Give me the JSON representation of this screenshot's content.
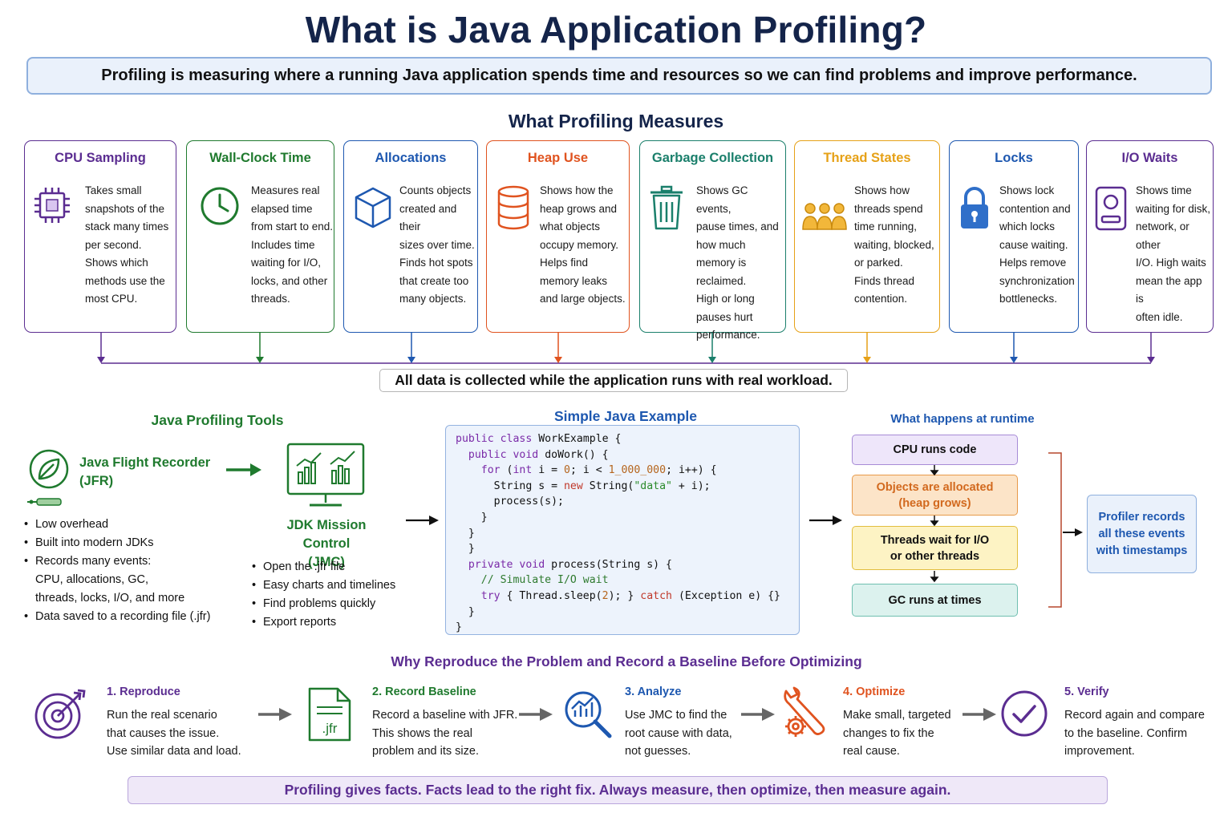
{
  "title": "What is Java Application Profiling?",
  "definition": "Profiling is measuring where a running Java application spends time and resources so we can find problems and improve performance.",
  "measures_heading": "What Profiling Measures",
  "measures": [
    {
      "title": "CPU Sampling",
      "icon": "cpu-chip-icon",
      "color": "#5b2d91",
      "lines": [
        "Takes small",
        "snapshots of the",
        "stack many times",
        "per second.",
        "Shows which",
        "methods use the",
        "most CPU."
      ]
    },
    {
      "title": "Wall-Clock Time",
      "icon": "clock-icon",
      "color": "#1f7a2e",
      "lines": [
        "Measures real",
        "elapsed time",
        "from start to end.",
        "Includes time",
        "waiting for I/O,",
        "locks, and other",
        "threads."
      ]
    },
    {
      "title": "Allocations",
      "icon": "cube-icon",
      "color": "#1e58b0",
      "lines": [
        "Counts objects",
        "created and their",
        "sizes over time.",
        "Finds hot spots",
        "that create too",
        "many objects."
      ]
    },
    {
      "title": "Heap Use",
      "icon": "database-icon",
      "color": "#e0531f",
      "lines": [
        "Shows how the",
        "heap grows and",
        "what objects",
        "occupy memory.",
        "Helps find",
        "memory leaks",
        "and large objects."
      ]
    },
    {
      "title": "Garbage Collection",
      "icon": "trash-can-icon",
      "color": "#1a7f6b",
      "lines": [
        "Shows GC events,",
        "pause times, and",
        "how much",
        "memory is",
        "reclaimed.",
        "High or long",
        "pauses hurt",
        "performance."
      ]
    },
    {
      "title": "Thread States",
      "icon": "people-group-icon",
      "color": "#e6a117",
      "lines": [
        "Shows how",
        "threads spend",
        "time running,",
        "waiting, blocked,",
        "or parked.",
        "Finds thread",
        "contention."
      ]
    },
    {
      "title": "Locks",
      "icon": "padlock-icon",
      "color": "#1e58b0",
      "lines": [
        "Shows lock",
        "contention and",
        "which locks",
        "cause waiting.",
        "Helps remove",
        "synchronization",
        "bottlenecks."
      ]
    },
    {
      "title": "I/O Waits",
      "icon": "disk-drive-icon",
      "color": "#5b2d91",
      "lines": [
        "Shows time",
        "waiting for disk,",
        "network, or other",
        "I/O. High waits",
        "mean the app is",
        "often idle."
      ]
    }
  ],
  "collect_note": "All data is collected while the application runs with real workload.",
  "tools": {
    "heading": "Java Profiling Tools",
    "jfr": {
      "title_line1": "Java Flight Recorder",
      "title_line2": "(JFR)",
      "bullets": [
        "Low overhead",
        "Built into modern JDKs",
        "Records many events:",
        "Data saved to a recording file (.jfr)"
      ],
      "records_detail": [
        "CPU, allocations, GC,",
        "threads, locks, I/O, and more"
      ]
    },
    "jmc": {
      "title_line1": "JDK Mission Control",
      "title_line2": "(JMC)",
      "bullets": [
        "Open the .jfr file",
        "Easy charts and timelines",
        "Find problems quickly",
        "Export reports"
      ]
    }
  },
  "code_example": {
    "heading": "Simple Java Example"
  },
  "runtime": {
    "heading": "What happens at runtime",
    "events": [
      {
        "line1": "CPU runs code",
        "line2": ""
      },
      {
        "line1": "Objects are allocated",
        "line2": "(heap grows)"
      },
      {
        "line1": "Threads wait for I/O",
        "line2": "or other threads"
      },
      {
        "line1": "GC runs at times",
        "line2": ""
      }
    ],
    "profiler": [
      "Profiler records",
      "all these events",
      "with timestamps"
    ]
  },
  "why_heading": "Why Reproduce the Problem and Record a Baseline Before Optimizing",
  "steps": [
    {
      "title": "1. Reproduce",
      "icon": "target-icon",
      "color": "#5b2d91",
      "lines": [
        "Run the real scenario",
        "that causes the issue.",
        "Use similar data and load."
      ]
    },
    {
      "title": "2. Record Baseline",
      "icon": "jfr-file-icon",
      "color": "#1f7a2e",
      "lines": [
        "Record a baseline with JFR.",
        "This shows the real",
        "problem and its size."
      ]
    },
    {
      "title": "3. Analyze",
      "icon": "magnifier-chart-icon",
      "color": "#1e58b0",
      "lines": [
        "Use JMC to find the",
        "root cause with data,",
        "not guesses."
      ]
    },
    {
      "title": "4. Optimize",
      "icon": "wrench-gear-icon",
      "color": "#e0531f",
      "lines": [
        "Make small, targeted",
        "changes to fix the",
        "real cause."
      ]
    },
    {
      "title": "5. Verify",
      "icon": "check-circle-icon",
      "color": "#5b2d91",
      "lines": [
        "Record again and compare",
        "to the baseline. Confirm",
        "improvement."
      ]
    }
  ],
  "footer": "Profiling gives facts. Facts lead to the right fix. Always measure, then optimize, then measure again."
}
